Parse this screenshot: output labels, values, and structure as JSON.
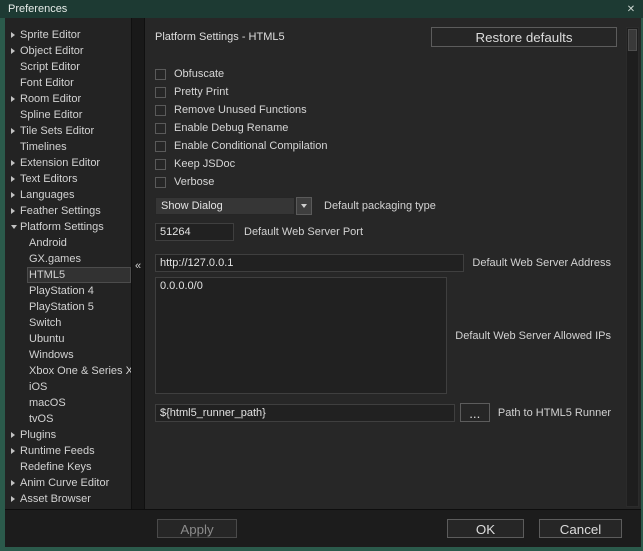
{
  "window": {
    "title": "Preferences"
  },
  "icons": {
    "close": "✕",
    "collapse": "«"
  },
  "sidebar": {
    "items": [
      {
        "label": "Sprite Editor",
        "arrow": "right",
        "level": 0
      },
      {
        "label": "Object Editor",
        "arrow": "right",
        "level": 0
      },
      {
        "label": "Script Editor",
        "arrow": "",
        "level": 0
      },
      {
        "label": "Font Editor",
        "arrow": "",
        "level": 0
      },
      {
        "label": "Room Editor",
        "arrow": "right",
        "level": 0
      },
      {
        "label": "Spline Editor",
        "arrow": "",
        "level": 0
      },
      {
        "label": "Tile Sets Editor",
        "arrow": "right",
        "level": 0
      },
      {
        "label": "Timelines",
        "arrow": "",
        "level": 0
      },
      {
        "label": "Extension Editor",
        "arrow": "right",
        "level": 0
      },
      {
        "label": "Text Editors",
        "arrow": "right",
        "level": 0
      },
      {
        "label": "Languages",
        "arrow": "right",
        "level": 0
      },
      {
        "label": "Feather Settings",
        "arrow": "right",
        "level": 0
      },
      {
        "label": "Platform Settings",
        "arrow": "down",
        "level": 0
      },
      {
        "label": "Android",
        "arrow": "",
        "level": 1
      },
      {
        "label": "GX.games",
        "arrow": "",
        "level": 1
      },
      {
        "label": "HTML5",
        "arrow": "",
        "level": 1,
        "selected": true
      },
      {
        "label": "PlayStation 4",
        "arrow": "",
        "level": 1
      },
      {
        "label": "PlayStation 5",
        "arrow": "",
        "level": 1
      },
      {
        "label": "Switch",
        "arrow": "",
        "level": 1
      },
      {
        "label": "Ubuntu",
        "arrow": "",
        "level": 1
      },
      {
        "label": "Windows",
        "arrow": "",
        "level": 1
      },
      {
        "label": "Xbox One & Series X",
        "arrow": "",
        "level": 1
      },
      {
        "label": "iOS",
        "arrow": "",
        "level": 1
      },
      {
        "label": "macOS",
        "arrow": "",
        "level": 1
      },
      {
        "label": "tvOS",
        "arrow": "",
        "level": 1
      },
      {
        "label": "Plugins",
        "arrow": "right",
        "level": 0
      },
      {
        "label": "Runtime Feeds",
        "arrow": "right",
        "level": 0
      },
      {
        "label": "Redefine Keys",
        "arrow": "",
        "level": 0
      },
      {
        "label": "Anim Curve Editor",
        "arrow": "right",
        "level": 0
      },
      {
        "label": "Asset Browser",
        "arrow": "right",
        "level": 0
      }
    ]
  },
  "main": {
    "header": {
      "title": "Platform Settings - HTML5",
      "restore_button": "Restore defaults"
    },
    "checkboxes": [
      {
        "label": "Obfuscate",
        "checked": false
      },
      {
        "label": "Pretty Print",
        "checked": false
      },
      {
        "label": "Remove Unused Functions",
        "checked": false
      },
      {
        "label": "Enable Debug Rename",
        "checked": false
      },
      {
        "label": "Enable Conditional Compilation",
        "checked": false
      },
      {
        "label": "Keep JSDoc",
        "checked": false
      },
      {
        "label": "Verbose",
        "checked": false
      }
    ],
    "packaging": {
      "value": "Show Dialog",
      "label": "Default packaging type"
    },
    "port": {
      "value": "51264",
      "label": "Default Web Server Port"
    },
    "address": {
      "value": "http://127.0.0.1",
      "label": "Default Web Server Address"
    },
    "allowed_ips": {
      "value": "0.0.0.0/0",
      "label": "Default Web Server Allowed IPs"
    },
    "runner_path": {
      "value": "${html5_runner_path}",
      "browse_button": "...",
      "label": "Path to HTML5 Runner"
    }
  },
  "footer": {
    "apply_label": "Apply",
    "ok_label": "OK",
    "cancel_label": "Cancel"
  }
}
